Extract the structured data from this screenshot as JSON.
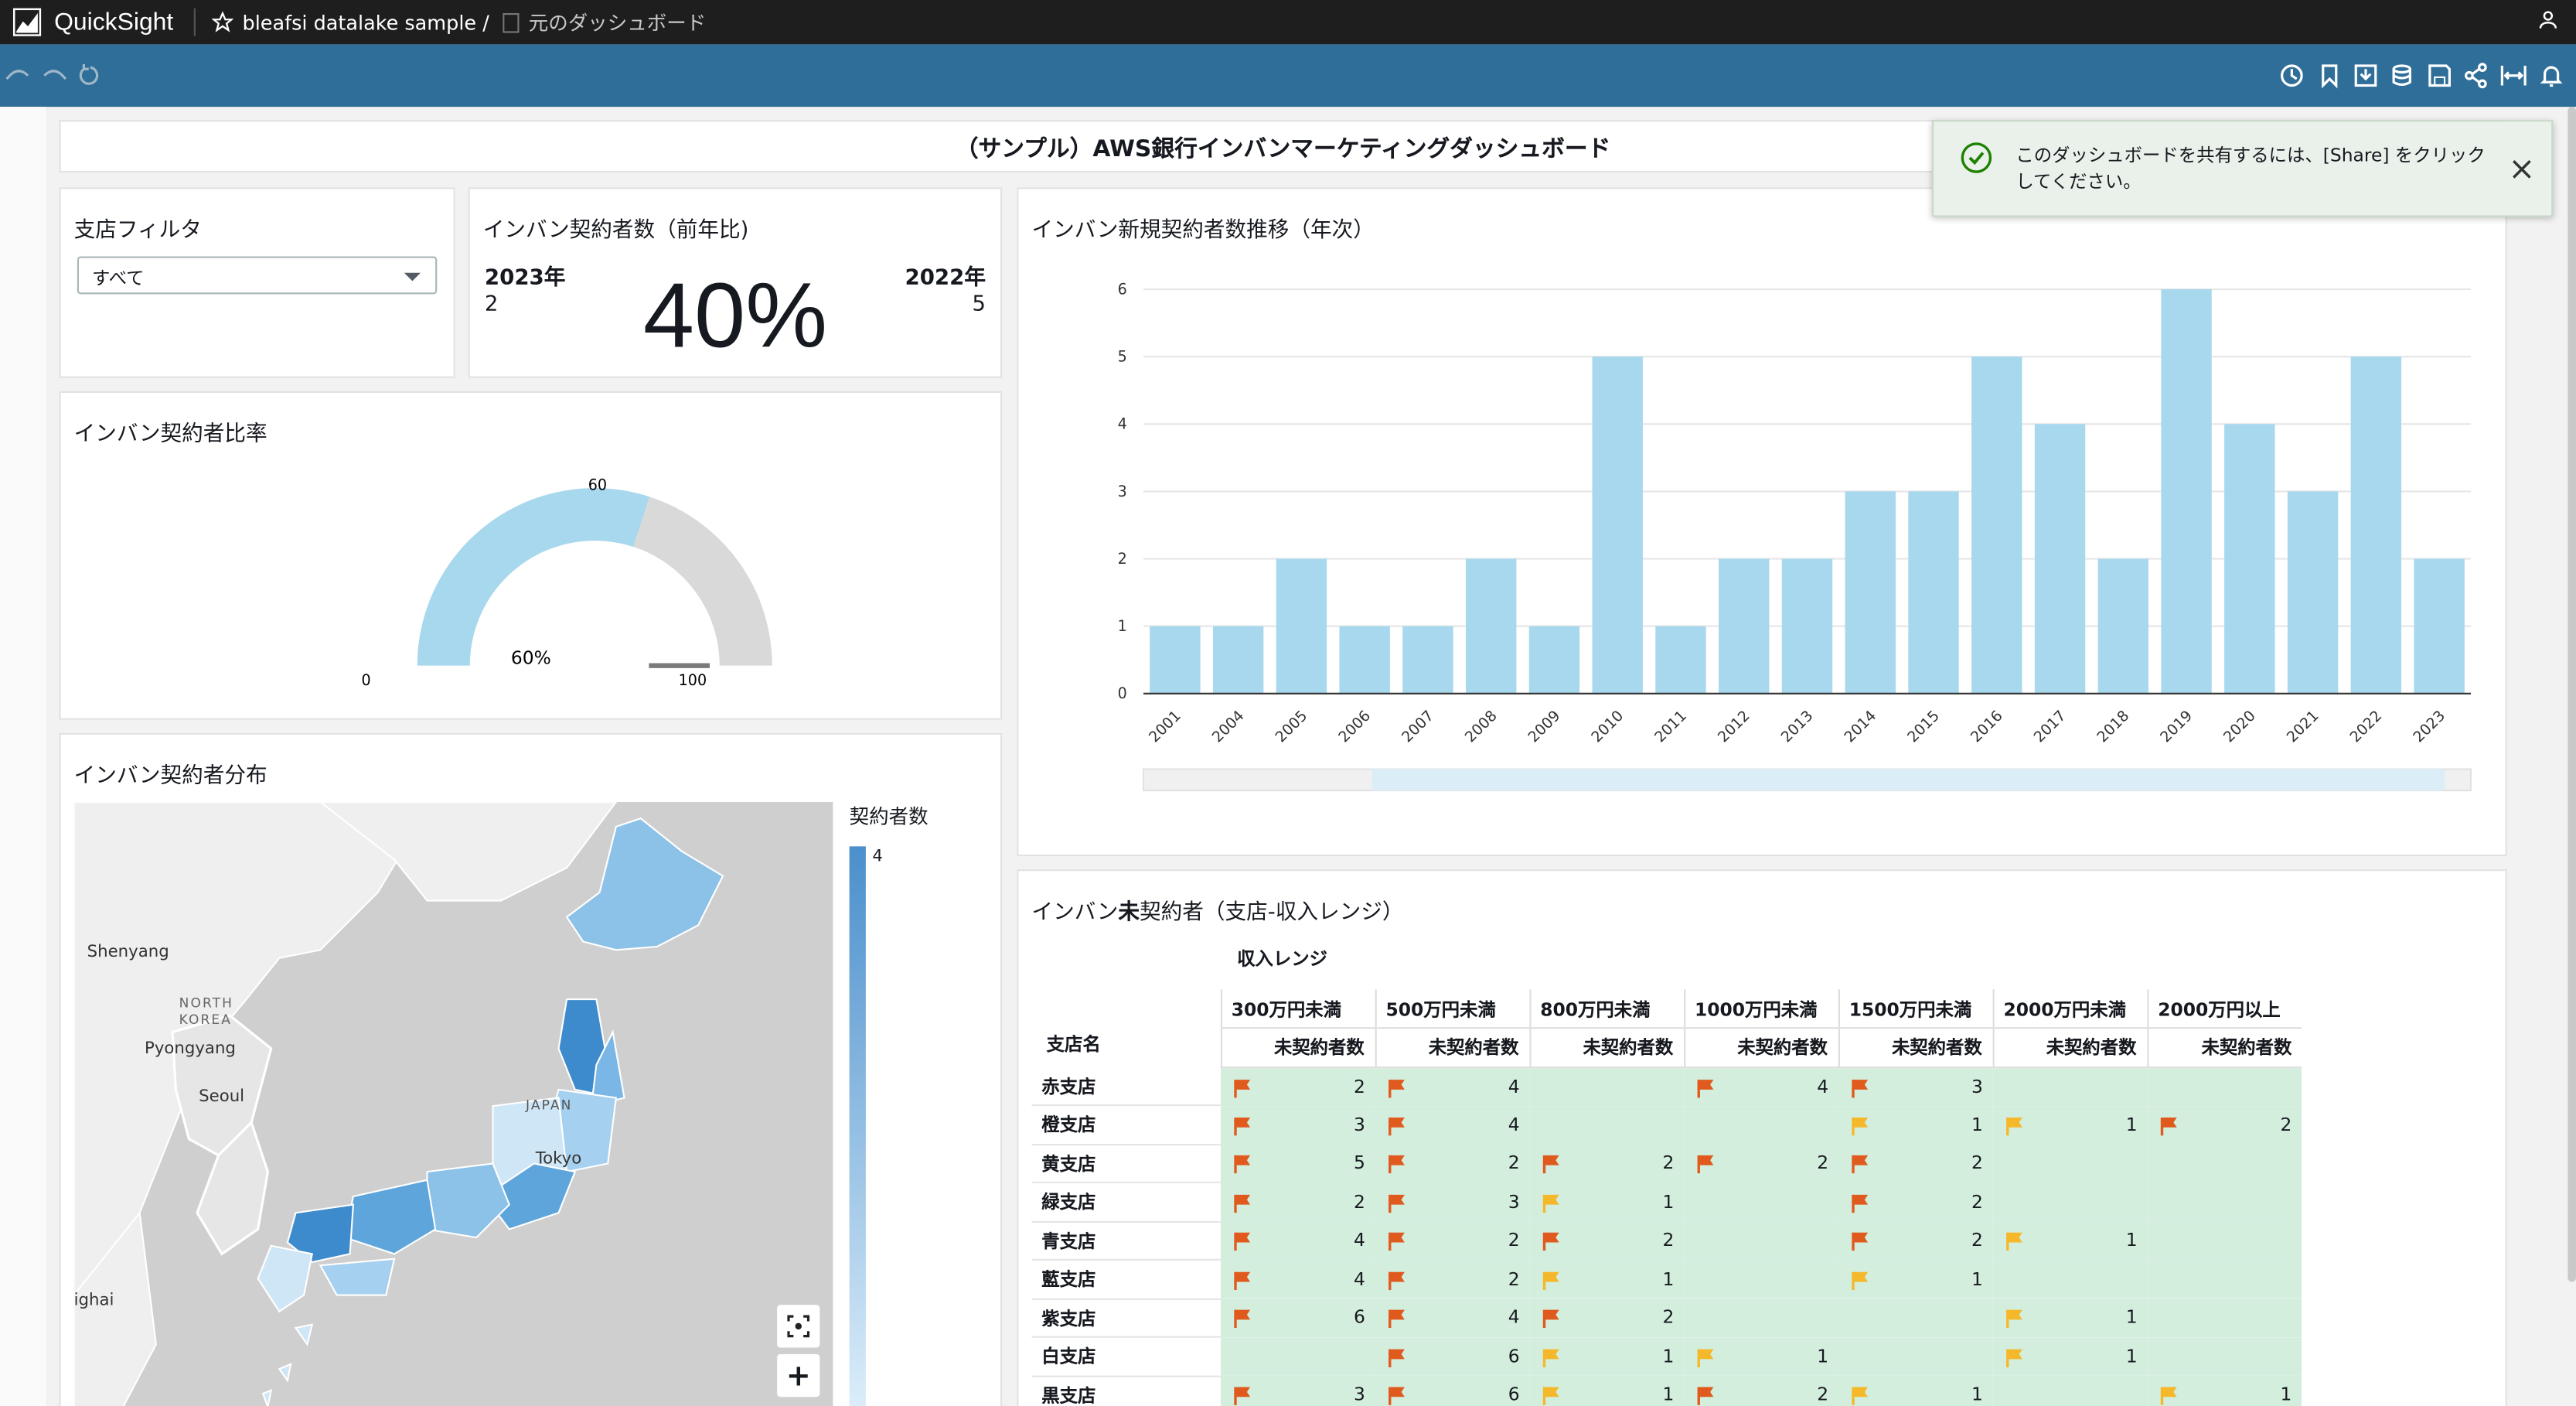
{
  "app": {
    "brand": "QuickSight",
    "dataset": "bleafsi datalake sample /",
    "dashboard": "元のダッシュボード"
  },
  "colors": {
    "accent": "#2f6e98",
    "bar": "#a8d8ee",
    "gauge_fill": "#a8d8ee",
    "gauge_track": "#d9d9d9",
    "cell_bg": "#d3eedd",
    "flag_red": "#e05a1e",
    "flag_yellow": "#f5b82a"
  },
  "icons": {
    "topbar": [
      "quicksight-logo-icon",
      "star-icon",
      "dashboard-icon",
      "user-icon"
    ],
    "toolbar_left": [
      "undo-icon",
      "redo-icon",
      "reset-icon"
    ],
    "toolbar_right": [
      "schedule-icon",
      "bookmark-icon",
      "download-icon",
      "dataset-icon",
      "save-icon",
      "share-icon",
      "fit-width-icon",
      "alert-icon"
    ]
  },
  "header": {
    "title": "（サンプル）AWS銀行インバンマーケティングダッシュボード"
  },
  "toast": {
    "message": "このダッシュボードを共有するには、[Share] をクリックしてください。"
  },
  "filter": {
    "title": "支店フィルタ",
    "selected": "すべて"
  },
  "kpi": {
    "title": "インバン契約者数（前年比)",
    "current_year": "2023年",
    "current_value": "2",
    "prev_year": "2022年",
    "prev_value": "5",
    "big_value": "40%"
  },
  "gauge": {
    "title": "インバン契約者比率",
    "value_label": "60%",
    "min_label": "0",
    "max_label": "100",
    "target_label": "60",
    "value": 60,
    "max": 100
  },
  "map": {
    "title": "インバン契約者分布",
    "legend_title": "契約者数",
    "legend_max": "4",
    "labels": {
      "shenyang": "Shenyang",
      "north": "NORTH",
      "korea": "KOREA",
      "pyongyang": "Pyongyang",
      "seoul": "Seoul",
      "japan": "JAPAN",
      "tokyo": "Tokyo",
      "shanghai": "ighai"
    },
    "zoom_in": "+"
  },
  "chart_data": {
    "type": "bar",
    "title": "インバン新規契約者数推移（年次）",
    "categories": [
      "2001",
      "2004",
      "2005",
      "2006",
      "2007",
      "2008",
      "2009",
      "2010",
      "2011",
      "2012",
      "2013",
      "2014",
      "2015",
      "2016",
      "2017",
      "2018",
      "2019",
      "2020",
      "2021",
      "2022",
      "2023"
    ],
    "values": [
      1,
      1,
      2,
      1,
      1,
      2,
      1,
      5,
      1,
      2,
      2,
      3,
      3,
      5,
      4,
      2,
      6,
      4,
      3,
      5,
      2
    ],
    "ylim": [
      0,
      6
    ],
    "yticks": [
      "0",
      "1",
      "2",
      "3",
      "4",
      "5",
      "6"
    ],
    "grid": true
  },
  "pivot": {
    "title_pre": "インバン",
    "title_strong": "未",
    "title_post": "契約者（支店-収入レンジ）",
    "group_header": "収入レンジ",
    "row_header": "支店名",
    "ranges": [
      "300万円未満",
      "500万円未満",
      "800万円未満",
      "1000万円未満",
      "1500万円未満",
      "2000万円未満",
      "2000万円以上"
    ],
    "metric": "未契約者数",
    "rows": [
      {
        "name": "赤支店",
        "cells": [
          [
            "2",
            "r"
          ],
          [
            "4",
            "r"
          ],
          [
            "",
            ""
          ],
          [
            "4",
            "r"
          ],
          [
            "3",
            "r"
          ],
          [
            "",
            ""
          ],
          [
            "",
            ""
          ]
        ]
      },
      {
        "name": "橙支店",
        "cells": [
          [
            "3",
            "r"
          ],
          [
            "4",
            "r"
          ],
          [
            "",
            ""
          ],
          [
            "",
            ""
          ],
          [
            "1",
            "y"
          ],
          [
            "1",
            "y"
          ],
          [
            "2",
            "r"
          ]
        ]
      },
      {
        "name": "黄支店",
        "cells": [
          [
            "5",
            "r"
          ],
          [
            "2",
            "r"
          ],
          [
            "2",
            "r"
          ],
          [
            "2",
            "r"
          ],
          [
            "2",
            "r"
          ],
          [
            "",
            ""
          ],
          [
            "",
            ""
          ]
        ]
      },
      {
        "name": "緑支店",
        "cells": [
          [
            "2",
            "r"
          ],
          [
            "3",
            "r"
          ],
          [
            "1",
            "y"
          ],
          [
            "",
            ""
          ],
          [
            "2",
            "r"
          ],
          [
            "",
            ""
          ],
          [
            "",
            ""
          ]
        ]
      },
      {
        "name": "青支店",
        "cells": [
          [
            "4",
            "r"
          ],
          [
            "2",
            "r"
          ],
          [
            "2",
            "r"
          ],
          [
            "",
            ""
          ],
          [
            "2",
            "r"
          ],
          [
            "1",
            "y"
          ],
          [
            "",
            ""
          ]
        ]
      },
      {
        "name": "藍支店",
        "cells": [
          [
            "4",
            "r"
          ],
          [
            "2",
            "r"
          ],
          [
            "1",
            "y"
          ],
          [
            "",
            ""
          ],
          [
            "1",
            "y"
          ],
          [
            "",
            ""
          ],
          [
            "",
            ""
          ]
        ]
      },
      {
        "name": "紫支店",
        "cells": [
          [
            "6",
            "r"
          ],
          [
            "4",
            "r"
          ],
          [
            "2",
            "r"
          ],
          [
            "",
            ""
          ],
          [
            "",
            ""
          ],
          [
            "1",
            "y"
          ],
          [
            "",
            ""
          ]
        ]
      },
      {
        "name": "白支店",
        "cells": [
          [
            "",
            ""
          ],
          [
            "6",
            "r"
          ],
          [
            "1",
            "y"
          ],
          [
            "1",
            "y"
          ],
          [
            "",
            ""
          ],
          [
            "1",
            "y"
          ],
          [
            "",
            ""
          ]
        ]
      },
      {
        "name": "黒支店",
        "cells": [
          [
            "3",
            "r"
          ],
          [
            "6",
            "r"
          ],
          [
            "1",
            "y"
          ],
          [
            "2",
            "r"
          ],
          [
            "1",
            "y"
          ],
          [
            "",
            ""
          ],
          [
            "1",
            "y"
          ]
        ]
      }
    ]
  }
}
